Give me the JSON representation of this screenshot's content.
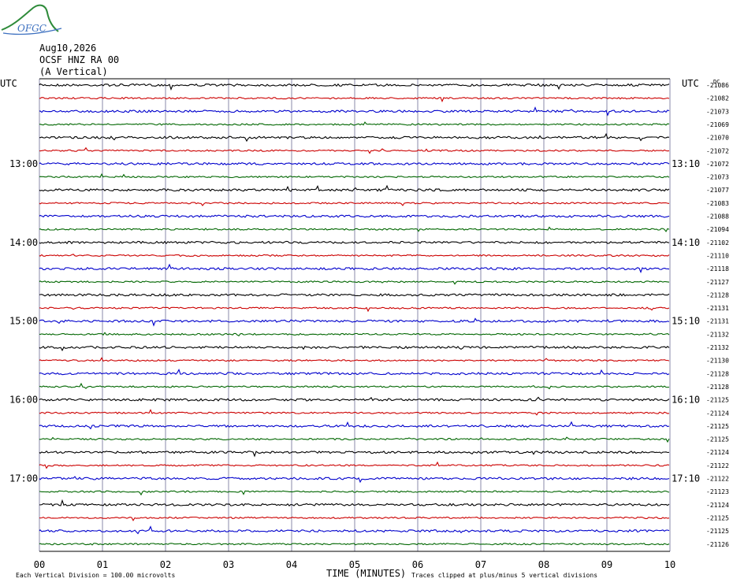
{
  "logo": {
    "text": "OFGC",
    "icon": "mountain-logo-icon"
  },
  "header": {
    "date": "Aug10,2026",
    "station": "OCSF HNZ RA 00",
    "component": "(A Vertical)"
  },
  "axes": {
    "left_corner": "UTC",
    "right_corner": "UTC",
    "dc_label": "DC",
    "xlabel": "TIME (MINUTES)",
    "x_ticks": [
      "00",
      "01",
      "02",
      "03",
      "04",
      "05",
      "06",
      "07",
      "08",
      "09",
      "10"
    ],
    "left_hour_labels": [
      "13:00",
      "14:00",
      "15:00",
      "16:00",
      "17:00"
    ],
    "right_hour_labels": [
      "13:10",
      "14:10",
      "15:10",
      "16:10",
      "17:10"
    ]
  },
  "footer": {
    "scale_note": "Each Vertical Division =  100.00 microvolts",
    "clip_note": "Traces clipped at plus/minus 5 vertical divisions"
  },
  "colors": {
    "trace_cycle": [
      "#000000",
      "#cc0000",
      "#0000cc",
      "#006600"
    ],
    "grid": "#8888aa"
  },
  "chart_data": {
    "type": "line",
    "title": "",
    "xlabel": "TIME (MINUTES)",
    "ylabel": "",
    "xlim": [
      0,
      10
    ],
    "minutes_per_trace": 10,
    "trace_count": 36,
    "dc_offsets": [
      -21086,
      -21082,
      -21073,
      -21069,
      -21070,
      -21072,
      -21072,
      -21073,
      -21077,
      -21083,
      -21088,
      -21094,
      -21102,
      -21110,
      -21118,
      -21127,
      -21128,
      -21131,
      -21131,
      -21132,
      -21132,
      -21130,
      -21128,
      -21128,
      -21125,
      -21124,
      -21125,
      -21125,
      -21124,
      -21122,
      -21122,
      -21123,
      -21124,
      -21125,
      -21125,
      -21126
    ]
  }
}
